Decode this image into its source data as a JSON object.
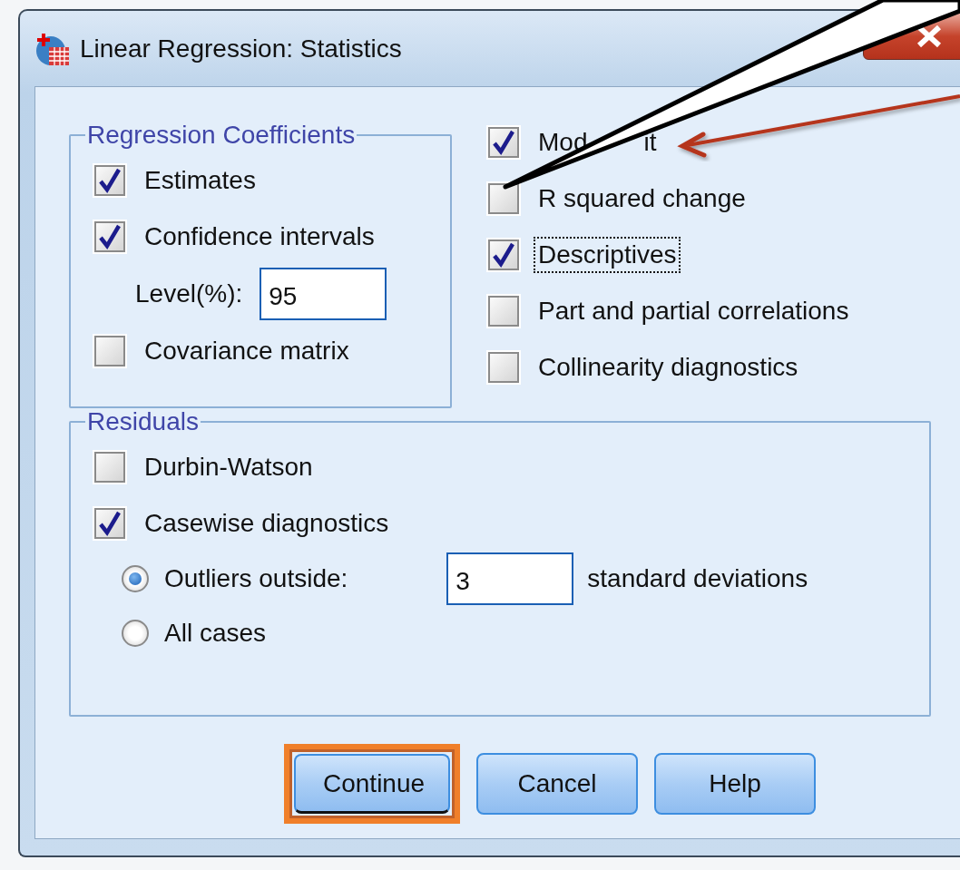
{
  "window": {
    "title": "Linear Regression: Statistics"
  },
  "regression_coefficients": {
    "title": "Regression Coefficients",
    "items": [
      {
        "kind": "checkbox",
        "label": "Estimates",
        "checked": true,
        "focused": false
      },
      {
        "kind": "checkbox",
        "label": "Confidence intervals",
        "checked": true,
        "focused": false
      },
      {
        "kind": "field",
        "label": "Level(%):",
        "value": "95"
      },
      {
        "kind": "checkbox",
        "label": "Covariance matrix",
        "checked": false,
        "focused": false
      }
    ]
  },
  "options": [
    {
      "kind": "checkbox",
      "label": "Mod",
      "label_tail": "it",
      "checked": true,
      "focused": false
    },
    {
      "kind": "checkbox",
      "label": "R squared change",
      "checked": false,
      "focused": false
    },
    {
      "kind": "checkbox",
      "label": "Descriptives",
      "checked": true,
      "focused": true
    },
    {
      "kind": "checkbox",
      "label": "Part and partial correlations",
      "checked": false,
      "focused": false
    },
    {
      "kind": "checkbox",
      "label": "Collinearity diagnostics",
      "checked": false,
      "focused": false
    }
  ],
  "residuals": {
    "title": "Residuals",
    "items": [
      {
        "kind": "checkbox",
        "label": "Durbin-Watson",
        "checked": false,
        "focused": false
      },
      {
        "kind": "checkbox",
        "label": "Casewise diagnostics",
        "checked": true,
        "focused": false
      },
      {
        "kind": "radio",
        "label": "Outliers outside:",
        "selected": true,
        "value": "3",
        "suffix": "standard deviations"
      },
      {
        "kind": "radio",
        "label": "All cases",
        "selected": false
      }
    ]
  },
  "buttons": [
    {
      "label": "Continue",
      "highlighted": true
    },
    {
      "label": "Cancel",
      "highlighted": false
    },
    {
      "label": "Help",
      "highlighted": false
    }
  ]
}
